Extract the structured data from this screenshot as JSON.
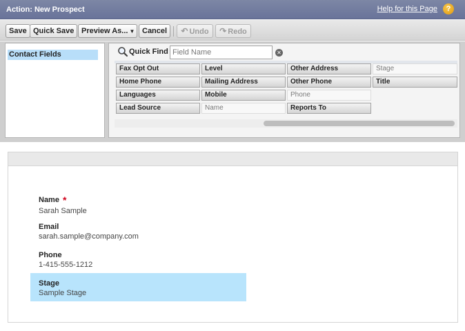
{
  "header": {
    "title": "Action: New Prospect",
    "help_link": "Help for this Page",
    "help_icon": "?",
    "help_icon_color": "#e8a61c"
  },
  "toolbar": {
    "save": "Save",
    "quick_save": "Quick Save",
    "preview_as": "Preview As...",
    "preview_arrow": "▼",
    "cancel": "Cancel",
    "undo": "Undo",
    "redo": "Redo"
  },
  "palette": {
    "categories": [
      "Contact Fields"
    ],
    "selected_category_color": "#b8def9",
    "quick_find": {
      "label": "Quick Find",
      "placeholder": "Field Name",
      "value": ""
    },
    "fields": [
      {
        "label": "Fax Opt Out",
        "state": "active"
      },
      {
        "label": "Level",
        "state": "active"
      },
      {
        "label": "Other Address",
        "state": "active"
      },
      {
        "label": "Stage",
        "state": "used"
      },
      {
        "label": "Home Phone",
        "state": "active"
      },
      {
        "label": "Mailing Address",
        "state": "active"
      },
      {
        "label": "Other Phone",
        "state": "active"
      },
      {
        "label": "Title",
        "state": "active"
      },
      {
        "label": "Languages",
        "state": "active"
      },
      {
        "label": "Mobile",
        "state": "active"
      },
      {
        "label": "Phone",
        "state": "used"
      },
      {
        "label": "Lead Source",
        "state": "active"
      },
      {
        "label": "Name",
        "state": "used"
      },
      {
        "label": "Reports To",
        "state": "active"
      }
    ]
  },
  "layout": {
    "fields": [
      {
        "label": "Name",
        "value": "Sarah Sample",
        "required": true
      },
      {
        "label": "Email",
        "value": "sarah.sample@company.com",
        "required": false
      },
      {
        "label": "Phone",
        "value": "1-415-555-1212",
        "required": false
      },
      {
        "label": "Stage",
        "value": "Sample Stage",
        "required": false,
        "selected": true
      }
    ],
    "required_marker": "*",
    "selected_color": "#b8e4fc"
  }
}
